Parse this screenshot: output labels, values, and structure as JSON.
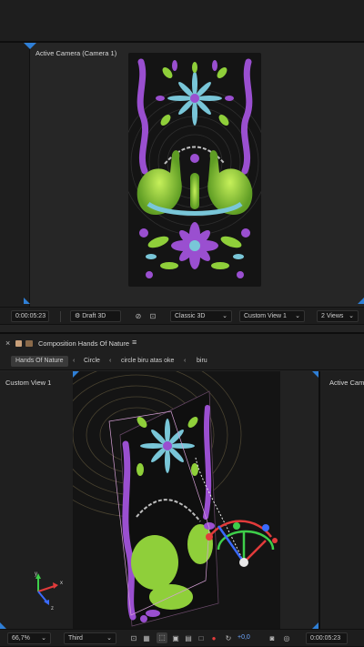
{
  "top_viewer": {
    "label": "Active Camera (Camera 1)"
  },
  "top_toolbar": {
    "timecode": "0:00:05:23",
    "draft_3d": "Draft 3D",
    "renderer": "Classic 3D",
    "view": "Custom View 1",
    "view_count": "2 Views"
  },
  "composition": {
    "panel_title": "Composition Hands Of Nature",
    "breadcrumbs": [
      "Hands Of Nature",
      "Circle",
      "circle biru atas oke",
      "biru"
    ]
  },
  "bottom_viewer": {
    "left_label": "Custom View 1",
    "right_label": "Active Cam"
  },
  "bottom_toolbar": {
    "zoom": "66,7%",
    "resolution": "Third",
    "exposure": "+0,0",
    "timecode": "0:00:05:23"
  },
  "colors": {
    "accent_blue": "#2f7fd6",
    "purple": "#9a4fd0",
    "green": "#8fcf3a",
    "cyan": "#79c6d8",
    "artboard_bg": "#141414"
  },
  "icons": {
    "close": "close-icon",
    "lock": "lock-icon",
    "menu": "hamburger-menu-icon",
    "chevron_left": "chevron-left-icon",
    "chevron_down": "chevron-down-icon",
    "camera": "camera-icon"
  }
}
